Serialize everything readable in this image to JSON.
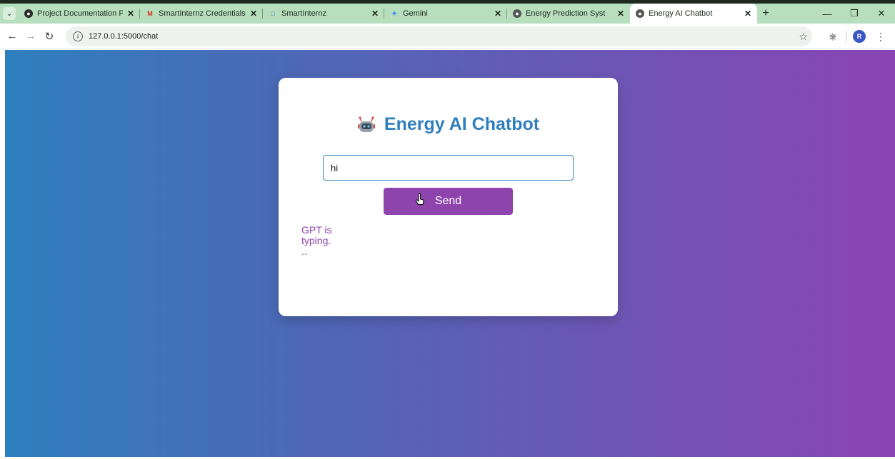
{
  "browser": {
    "tabs": [
      {
        "title": "Project Documentation Pr",
        "icon": "globe-icon",
        "active": false
      },
      {
        "title": "SmartInternz Credentials f",
        "icon": "gmail-icon",
        "active": false
      },
      {
        "title": "SmartInternz",
        "icon": "smartinternz-icon",
        "active": false
      },
      {
        "title": "Gemini",
        "icon": "gemini-icon",
        "active": false
      },
      {
        "title": "Energy Prediction Syst",
        "icon": "globe-icon",
        "active": false
      },
      {
        "title": "Energy AI Chatbot",
        "icon": "globe-icon",
        "active": true
      }
    ],
    "address": "127.0.0.1:5000/chat",
    "profile_initial": "R",
    "accent_color": "#b7dfbd"
  },
  "page": {
    "title": "Energy AI Chatbot",
    "title_icon": "robot-icon",
    "title_color": "#2f7fbf",
    "input_value": "hi",
    "send_label": "Send",
    "status_text": "GPT is typing...",
    "button_color": "#8e44ad"
  }
}
